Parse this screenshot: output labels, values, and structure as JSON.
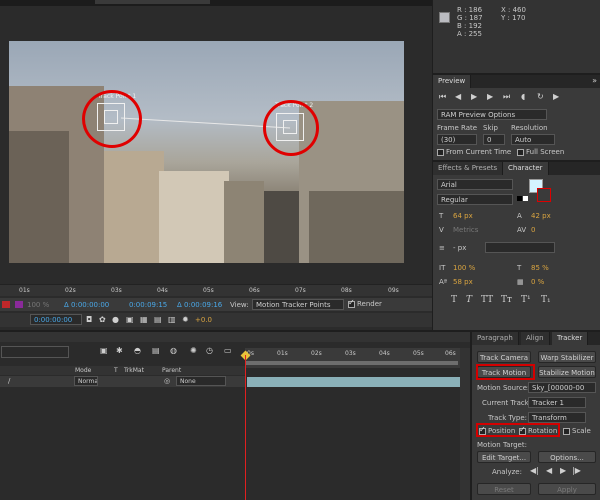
{
  "info": {
    "r": "R : 186",
    "g": "G : 187",
    "b": "B : 192",
    "a": "A : 255",
    "x": "X : 460",
    "y": "Y : 170",
    "swatch": "#babbc0"
  },
  "preview": {
    "tab": "Preview",
    "ram_options": "RAM Preview Options",
    "frame_rate_label": "Frame Rate",
    "frame_rate_value": "(30)",
    "skip_label": "Skip",
    "skip_value": "0",
    "resolution_label": "Resolution",
    "resolution_value": "Auto",
    "from_current": "From Current Time",
    "full_screen": "Full Screen"
  },
  "character": {
    "tabs": [
      "Effects & Presets",
      "Character"
    ],
    "font": "Arial",
    "style": "Regular",
    "size": "64 px",
    "leading": "42 px",
    "kerning": "Metrics",
    "tracking": "0",
    "stroke_width": "- px",
    "vscale": "100 %",
    "hscale": "85 %",
    "baseline": "58 px",
    "tsume": "0 %"
  },
  "viewer": {
    "track_point_1": "Track Point 1",
    "track_point_2": "Track Point 2",
    "ruler": [
      "01s",
      "02s",
      "03s",
      "04s",
      "05s",
      "06s",
      "07s",
      "08s",
      "09s"
    ],
    "zoom": "100 %",
    "time1": "Δ 0:00:00:00",
    "time2": "0:00:09:15",
    "time3": "Δ 0:00:09:16",
    "view_label": "View:",
    "view_value": "Motion Tracker Points",
    "render": "Render",
    "current_time": "0:00:00:00",
    "exposure": "+0.0"
  },
  "timeline": {
    "col_mode": "Mode",
    "col_t": "T",
    "col_trkmat": "TrkMat",
    "col_parent": "Parent",
    "layer_mode": "Normal",
    "layer_parent": "None",
    "ruler": [
      "0s",
      "01s",
      "02s",
      "03s",
      "04s",
      "05s",
      "06s"
    ]
  },
  "tracker": {
    "tabs": [
      "Paragraph",
      "Align",
      "Tracker"
    ],
    "track_camera": "Track Camera",
    "warp_stabilizer": "Warp Stabilizer",
    "track_motion": "Track Motion",
    "stabilize_motion": "Stabilize Motion",
    "motion_source_label": "Motion Source:",
    "motion_source_value": "Sky_[00000-00",
    "current_track_label": "Current Track:",
    "current_track_value": "Tracker 1",
    "track_type_label": "Track Type:",
    "track_type_value": "Transform",
    "position": "Position",
    "rotation": "Rotation",
    "scale": "Scale",
    "motion_target_label": "Motion Target:",
    "edit_target": "Edit Target...",
    "options": "Options...",
    "analyze_label": "Analyze:",
    "reset": "Reset",
    "apply": "Apply"
  }
}
